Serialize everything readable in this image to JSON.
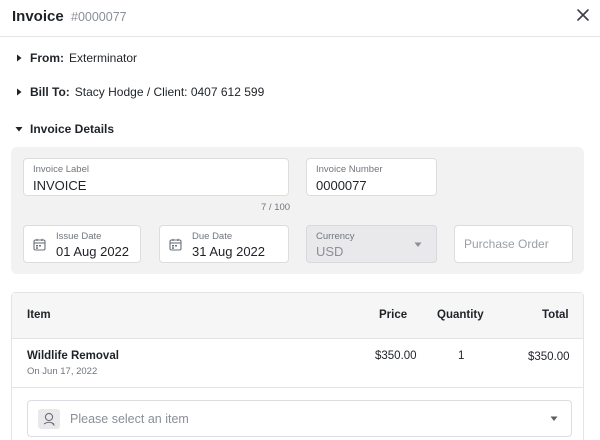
{
  "header": {
    "title": "Invoice",
    "invoice_id": "#0000077"
  },
  "from": {
    "label": "From:",
    "value": "Exterminator"
  },
  "bill_to": {
    "label": "Bill To:",
    "value": "Stacy Hodge / Client: 0407 612 599"
  },
  "details": {
    "label": "Invoice Details",
    "invoice_label": {
      "label": "Invoice Label",
      "value": "INVOICE",
      "counter": "7 / 100"
    },
    "invoice_number": {
      "label": "Invoice Number",
      "value": "0000077"
    },
    "issue_date": {
      "label": "Issue Date",
      "value": "01 Aug 2022"
    },
    "due_date": {
      "label": "Due Date",
      "value": "31 Aug 2022"
    },
    "currency": {
      "label": "Currency",
      "value": "USD"
    },
    "purchase_order": {
      "placeholder": "Purchase Order"
    }
  },
  "table": {
    "headers": {
      "item": "Item",
      "price": "Price",
      "quantity": "Quantity",
      "total": "Total"
    },
    "rows": [
      {
        "name": "Wildlife Removal",
        "date": "On Jun 17, 2022",
        "price": "$350.00",
        "quantity": "1",
        "total": "$350.00"
      }
    ],
    "select_placeholder": "Please select an item"
  },
  "icons": {
    "close": "close-icon",
    "caret_right": "caret-right-icon",
    "caret_down": "caret-down-icon",
    "calendar": "calendar-icon",
    "chevron": "chevron-down-icon",
    "item": "item-icon"
  }
}
